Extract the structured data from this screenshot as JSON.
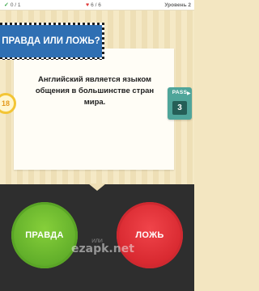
{
  "status_bar": {
    "correct_count": "0 / 1",
    "lives": "6 / 6",
    "level": "Уровень 2",
    "icons": {
      "correct": "check-icon",
      "lives": "heart-icon"
    },
    "colors": {
      "check": "#3aa84a",
      "heart": "#e03a3a"
    }
  },
  "header": {
    "title": "ПРАВДА ИЛИ ЛОЖЬ?",
    "color": "#2f6fb3"
  },
  "timer": {
    "value": "18"
  },
  "question": {
    "text": "Английский является языком общения в большинстве стран мира."
  },
  "pass": {
    "label": "PASS",
    "count": "3",
    "color": "#4fa59a"
  },
  "answers": {
    "true_label": "ПРАВДА",
    "or_label": "ИЛИ",
    "false_label": "ЛОЖЬ",
    "true_color": "#63b02b",
    "false_color": "#d92a31"
  },
  "watermark": {
    "text": "ezapk.net"
  }
}
